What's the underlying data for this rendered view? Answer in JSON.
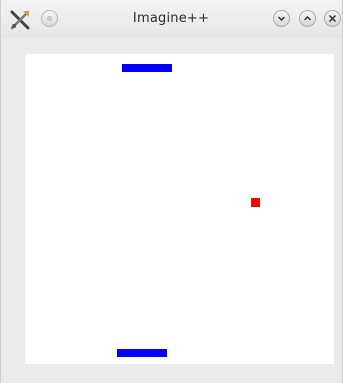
{
  "window": {
    "title": "Imagine++",
    "icon": "imagine-tools-icon",
    "buttons": [
      "sticky-icon",
      "minimize-icon",
      "maximize-icon",
      "close-icon"
    ]
  },
  "game": {
    "background_color": "#ffffff",
    "paddle_color": "#0000ff",
    "ball_color": "#ff0000"
  }
}
